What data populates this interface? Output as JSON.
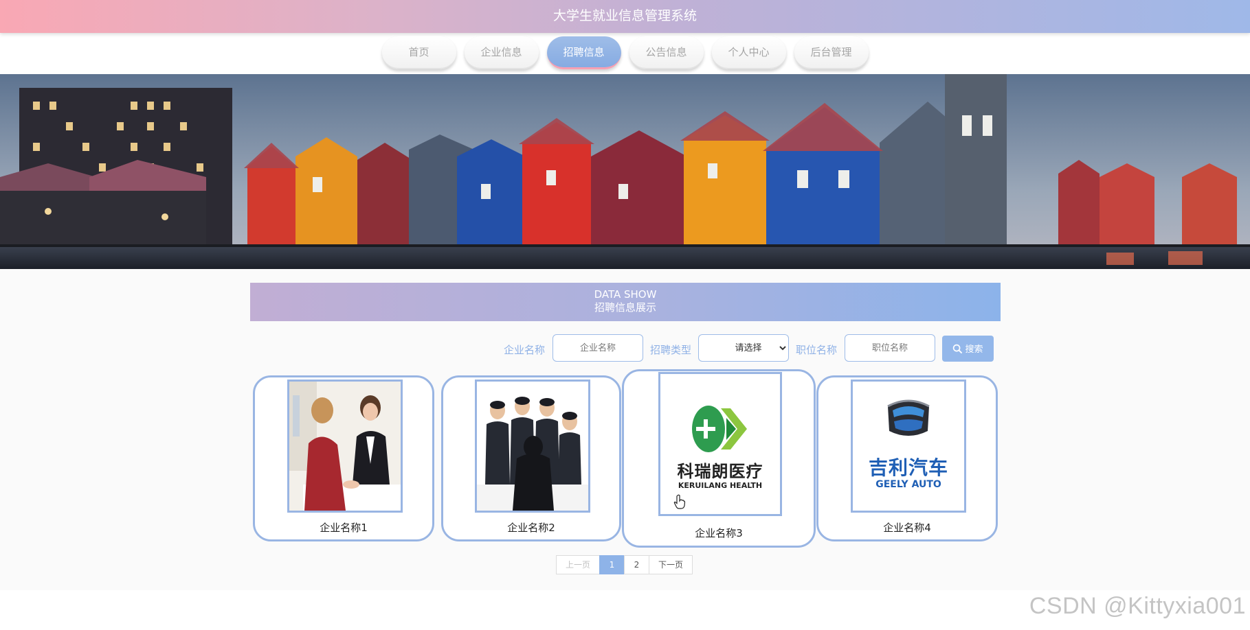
{
  "header": {
    "title": "大学生就业信息管理系统"
  },
  "nav": {
    "items": [
      {
        "label": "首页"
      },
      {
        "label": "企业信息"
      },
      {
        "label": "招聘信息"
      },
      {
        "label": "公告信息"
      },
      {
        "label": "个人中心"
      },
      {
        "label": "后台管理"
      }
    ],
    "active": "招聘信息"
  },
  "section": {
    "title_en": "DATA SHOW",
    "title_cn": "招聘信息展示"
  },
  "search": {
    "company_label": "企业名称",
    "company_placeholder": "企业名称",
    "type_label": "招聘类型",
    "type_selected": "请选择",
    "position_label": "职位名称",
    "position_placeholder": "职位名称",
    "button_label": "搜索"
  },
  "cards": [
    {
      "name": "企业名称1",
      "image": "interview-photo"
    },
    {
      "name": "企业名称2",
      "image": "business-team-photo"
    },
    {
      "name": "企业名称3",
      "image": "keruilang-health-logo",
      "logo_text_cn": "科瑞朗医疗",
      "logo_text_en": "KERUILANG HEALTH"
    },
    {
      "name": "企业名称4",
      "image": "geely-auto-logo",
      "logo_text_cn": "吉利汽车",
      "logo_text_en": "GEELY AUTO"
    }
  ],
  "pagination": {
    "prev": "上一页",
    "pages": [
      "1",
      "2"
    ],
    "current": "1",
    "next": "下一页"
  },
  "watermark": "CSDN @Kittyxia001",
  "colors": {
    "accent": "#8eb3e8",
    "pink": "#f9a8b4",
    "lavender": "#c1aed4"
  }
}
